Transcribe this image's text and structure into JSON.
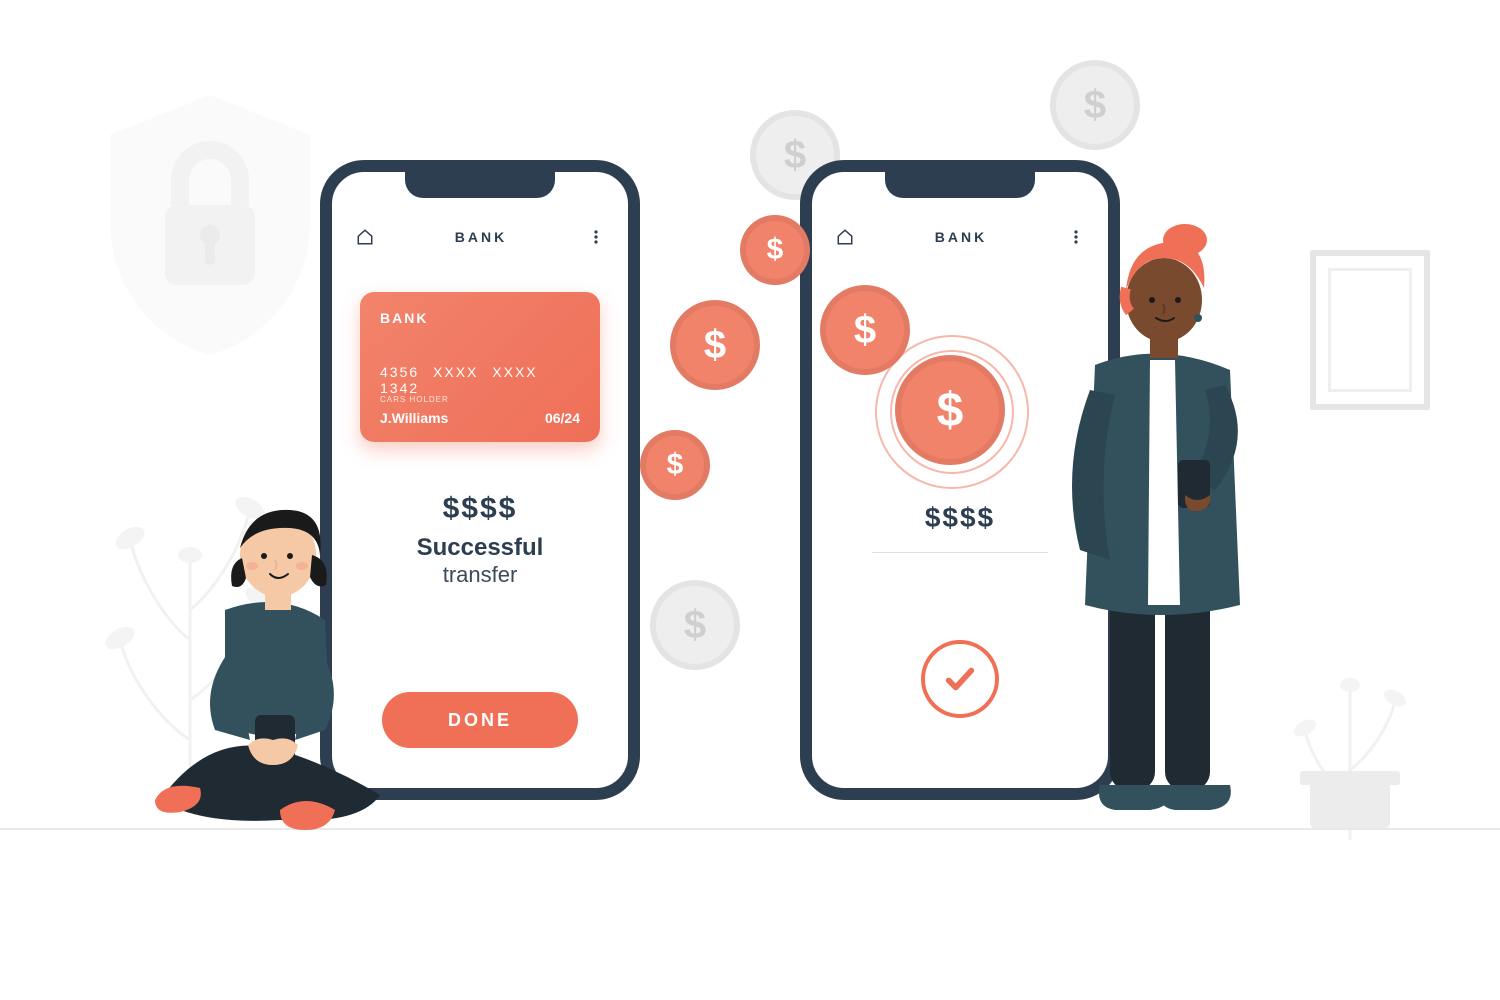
{
  "phone_left": {
    "title": "BANK",
    "card": {
      "bank_label": "BANK",
      "number": "4356  XXXX  XXXX  1342",
      "holder_label": "CARS HOLDER",
      "holder_name": "J.Williams",
      "expiry": "06/24"
    },
    "amount_display": "$$$$",
    "status_line1": "Successful",
    "status_line2": "transfer",
    "done_button": "DONE"
  },
  "phone_right": {
    "title": "BANK",
    "amount_display": "$$$$"
  },
  "colors": {
    "accent": "#ef6f57",
    "phone_frame": "#2c3e50"
  }
}
